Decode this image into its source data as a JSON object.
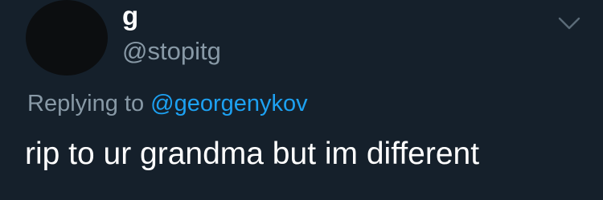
{
  "tweet": {
    "author": {
      "display_name": "g",
      "handle": "@stopitg"
    },
    "menu_icon": "chevron-down-icon",
    "reply": {
      "prefix": "Replying to",
      "mention": "@georgenykov"
    },
    "text": "rip to ur grandma but im different"
  },
  "colors": {
    "background": "#15202b",
    "avatar": "#0c0e10",
    "primary_text": "#ffffff",
    "secondary_text": "#8899a6",
    "link": "#1da1f2"
  }
}
